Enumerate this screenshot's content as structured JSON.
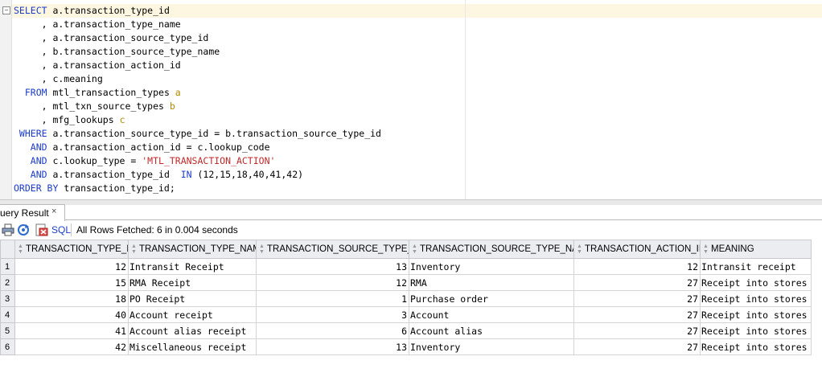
{
  "editor": {
    "lines": [
      [
        {
          "t": "SELECT ",
          "c": "kw"
        },
        {
          "t": "a.transaction_type_id"
        }
      ],
      [
        {
          "t": "     , a.transaction_type_name"
        }
      ],
      [
        {
          "t": "     , a.transaction_source_type_id"
        }
      ],
      [
        {
          "t": "     , b.transaction_source_type_name"
        }
      ],
      [
        {
          "t": "     , a.transaction_action_id"
        }
      ],
      [
        {
          "t": "     , c.meaning"
        }
      ],
      [
        {
          "t": "  FROM ",
          "c": "kw"
        },
        {
          "t": "mtl_transaction_types "
        },
        {
          "t": "a",
          "c": "alias"
        }
      ],
      [
        {
          "t": "     , mtl_txn_source_types "
        },
        {
          "t": "b",
          "c": "alias"
        }
      ],
      [
        {
          "t": "     , mfg_lookups "
        },
        {
          "t": "c",
          "c": "alias"
        }
      ],
      [
        {
          "t": " WHERE ",
          "c": "kw"
        },
        {
          "t": "a.transaction_source_type_id = b.transaction_source_type_id"
        }
      ],
      [
        {
          "t": "   AND ",
          "c": "kw"
        },
        {
          "t": "a.transaction_action_id = c.lookup_code"
        }
      ],
      [
        {
          "t": "   AND ",
          "c": "kw"
        },
        {
          "t": "c.lookup_type = "
        },
        {
          "t": "'MTL_TRANSACTION_ACTION'",
          "c": "str"
        }
      ],
      [
        {
          "t": "   AND ",
          "c": "kw"
        },
        {
          "t": "a.transaction_type_id  "
        },
        {
          "t": "IN",
          "c": "kw"
        },
        {
          "t": " (12,15,18,40,41,42)"
        }
      ],
      [
        {
          "t": "ORDER BY ",
          "c": "kw"
        },
        {
          "t": "transaction_type_id;"
        }
      ]
    ]
  },
  "result_panel": {
    "tab_label": "uery Result",
    "tab_close": "×",
    "sql_label": "SQL",
    "status": "All Rows Fetched: 6 in 0.004 seconds"
  },
  "grid": {
    "columns": [
      {
        "label": "TRANSACTION_TYPE_ID",
        "align": "num"
      },
      {
        "label": "TRANSACTION_TYPE_NAME",
        "align": "txt"
      },
      {
        "label": "TRANSACTION_SOURCE_TYPE_ID",
        "align": "num"
      },
      {
        "label": "TRANSACTION_SOURCE_TYPE_NAME",
        "align": "txt"
      },
      {
        "label": "TRANSACTION_ACTION_ID",
        "align": "num"
      },
      {
        "label": "MEANING",
        "align": "txt"
      }
    ],
    "rows": [
      [
        "1",
        "12",
        "Intransit Receipt",
        "13",
        "Inventory",
        "12",
        "Intransit receipt"
      ],
      [
        "2",
        "15",
        "RMA Receipt",
        "12",
        "RMA",
        "27",
        "Receipt into stores"
      ],
      [
        "3",
        "18",
        "PO Receipt",
        "1",
        "Purchase order",
        "27",
        "Receipt into stores"
      ],
      [
        "4",
        "40",
        "Account receipt",
        "3",
        "Account",
        "27",
        "Receipt into stores"
      ],
      [
        "5",
        "41",
        "Account alias receipt",
        "6",
        "Account alias",
        "27",
        "Receipt into stores"
      ],
      [
        "6",
        "42",
        "Miscellaneous receipt",
        "13",
        "Inventory",
        "27",
        "Receipt into stores"
      ]
    ]
  },
  "icons": {
    "fold": "minus-fold-icon",
    "print": "print-icon",
    "refresh": "refresh-icon",
    "export": "export-icon",
    "sort": "sort-arrows-icon"
  }
}
